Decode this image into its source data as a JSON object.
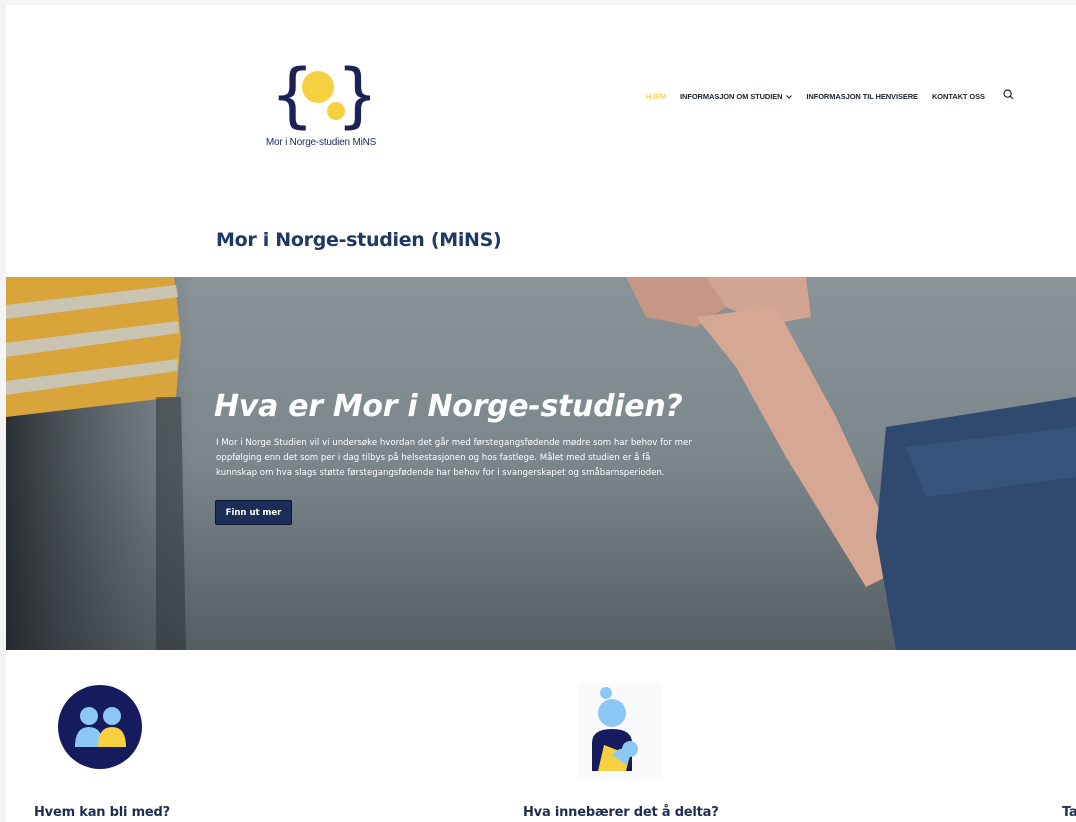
{
  "header": {
    "logo_text": "Mor i Norge-studien MiNS",
    "nav": [
      {
        "label": "HJEM",
        "active": true
      },
      {
        "label": "INFORMASJON OM STUDIEN",
        "has_dropdown": true
      },
      {
        "label": "INFORMASJON TIL HENVISERE"
      },
      {
        "label": "KONTAKT OSS"
      }
    ]
  },
  "page_title": "Mor i Norge-studien (MiNS)",
  "hero": {
    "title": "Hva er Mor i Norge-studien?",
    "text": "I Mor i Norge Studien vil vi undersøke hvordan det går med førstegangsfødende mødre som har behov for mer oppfølging enn det som per i dag tilbys på helsestasjonen og hos fastlege. Målet med studien er å få kunnskap om hva slags støtte førstegangsfødende har behov for i svangerskapet og småbarnsperioden.",
    "button_label": "Finn ut mer"
  },
  "features": [
    {
      "heading": "Hvem kan bli med?",
      "icon": "people-icon"
    },
    {
      "heading": "Hva innebærer det å delta?",
      "icon": "mother-child-icon"
    },
    {
      "heading": "Ta",
      "icon": ""
    }
  ],
  "colors": {
    "navy": "#1c2d57",
    "accent_yellow": "#f5d142",
    "light_blue": "#8cc8f5",
    "title_blue": "#1f3864"
  }
}
